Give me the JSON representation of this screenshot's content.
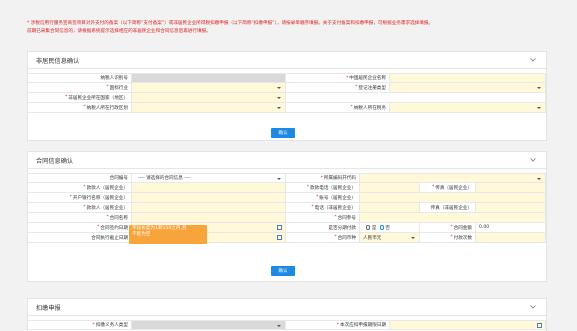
{
  "notice": {
    "line1": "* 涉税信用行服务宣商签项目对外支付的备案（以下简称“支付备案”）或非居民企业所得税扣缴申报（以下简称“扣缴申报”），请按录单顺序填报。关于支付备案和扣缴申报，可根据业务需求选择填报。",
    "line2": "前期已采集合同信息的，请根据系统提示选择相应的非居民企业和合同信息后再进行填报。"
  },
  "section1": {
    "title": "非居民信息确认",
    "rows": [
      [
        {
          "label": "纳税人识别号",
          "required": false
        },
        {
          "label": "中国居民企业名称",
          "required": true
        }
      ],
      [
        {
          "label": "国标行业",
          "required": true
        },
        {
          "label": "登记注册类型",
          "required": true
        }
      ],
      [
        {
          "label": "非居民企业所在国家（地区）",
          "required": true
        },
        {
          "label": "",
          "required": false
        }
      ],
      [
        {
          "label": "纳税人所在行政区划",
          "required": true
        },
        {
          "label": "纳税人所在税务",
          "required": true
        }
      ]
    ],
    "button": "确认"
  },
  "section2": {
    "title": "合同信息确认",
    "contract_select_label": "合同编号",
    "contract_select_value": "---- 请选择的合同信息 ----",
    "labels": {
      "biz_code": "所属编码开代码",
      "payee_cn": "款款人（居民企业）",
      "phone_cn": "款款电话（居民企业）",
      "fax": "传真（居民企业）",
      "bank": "开户银行名称（居民企业）",
      "account": "账号（居民企业）",
      "payer_cn": "款款人（居民企业）",
      "payer_phone": "电话（非居民企业）",
      "payer_fax": "传真（非居民企业）",
      "contract_name": "合同名称",
      "contract_no": "合同参号",
      "sign_date": "合同签约日期",
      "installment": "是否分期付款",
      "amount": "合同金额",
      "exec_end": "合同执行截止日期",
      "currency": "合同币种",
      "pay_times": "付款次数"
    },
    "radio_yes": "是",
    "radio_no": "否",
    "amount_value": "0.00",
    "currency_value": "人民币元",
    "tooltip_line1": "字段长度为1到150之内,且",
    "tooltip_line2": "不能为空",
    "button": "确认"
  },
  "section3": {
    "title": "扣缴申报",
    "labels": {
      "agent_type": "扣缴义务人类型",
      "due_date": "本次应扣申报期限日期"
    }
  }
}
